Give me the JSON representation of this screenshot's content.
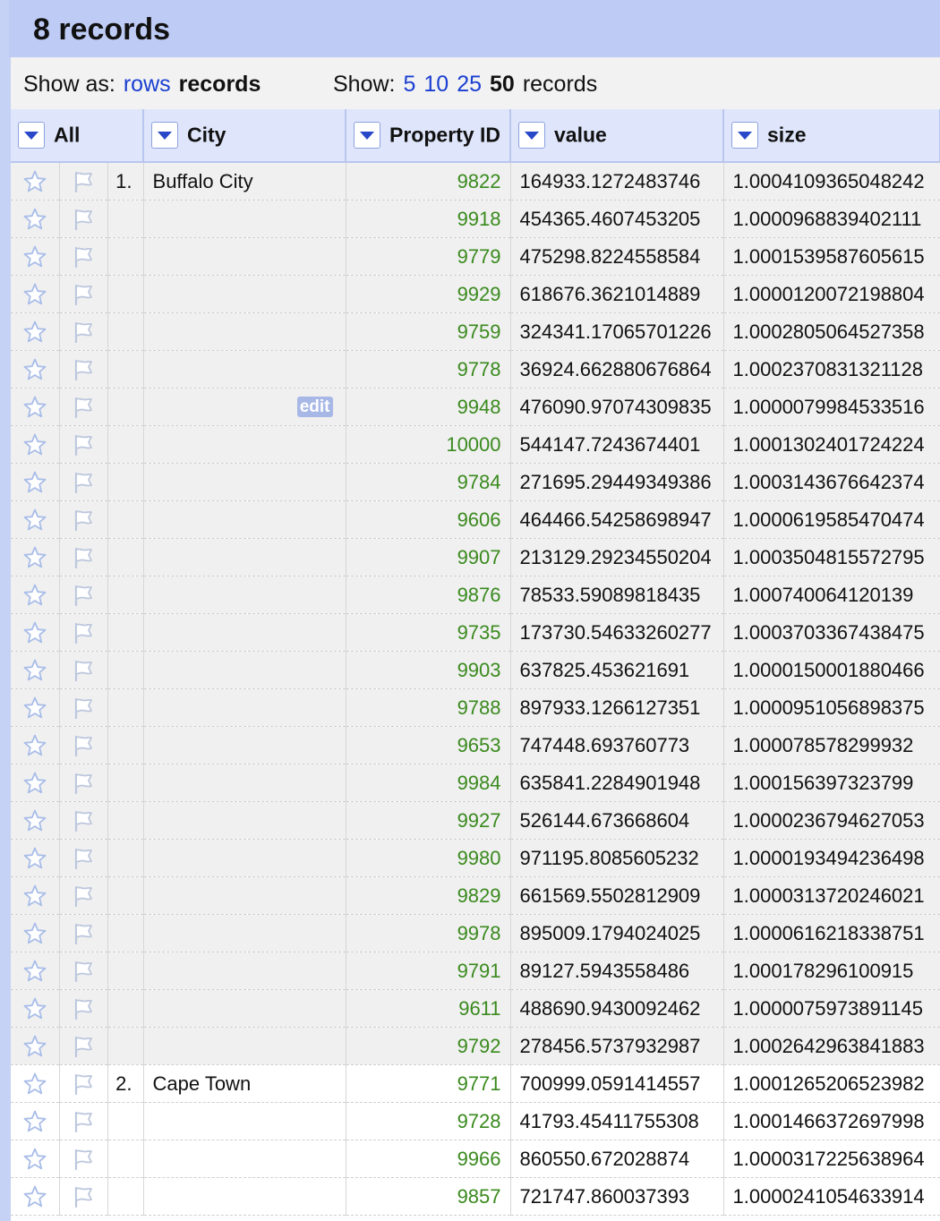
{
  "header": {
    "title": "8 records"
  },
  "controls": {
    "show_as_label": "Show as:",
    "show_as_rows": "rows",
    "show_as_records": "records",
    "show_label": "Show:",
    "page_sizes": [
      "5",
      "10",
      "25",
      "50"
    ],
    "page_size_selected": "50",
    "show_suffix": "records"
  },
  "columns": [
    {
      "label": "All"
    },
    {
      "label": "City"
    },
    {
      "label": "Property ID"
    },
    {
      "label": "value"
    },
    {
      "label": "size"
    }
  ],
  "edit_label": "edit",
  "icons": {
    "star": "star-outline-icon",
    "flag": "flag-outline-icon"
  },
  "colors": {
    "property_id": "#3a8a1e",
    "link": "#1a3fd1",
    "header_bg": "#bdcbf5"
  },
  "rows": [
    {
      "index": "1.",
      "city": "Buffalo City",
      "pid": "9822",
      "value": "164933.1272483746",
      "size": "1.0004109365048242",
      "group": 1
    },
    {
      "index": "",
      "city": "",
      "pid": "9918",
      "value": "454365.4607453205",
      "size": "1.0000968839402111",
      "group": 1
    },
    {
      "index": "",
      "city": "",
      "pid": "9779",
      "value": "475298.8224558584",
      "size": "1.0001539587605615",
      "group": 1
    },
    {
      "index": "",
      "city": "",
      "pid": "9929",
      "value": "618676.3621014889",
      "size": "1.0000120072198804",
      "group": 1
    },
    {
      "index": "",
      "city": "",
      "pid": "9759",
      "value": "324341.17065701226",
      "size": "1.0002805064527358",
      "group": 1
    },
    {
      "index": "",
      "city": "",
      "pid": "9778",
      "value": "36924.662880676864",
      "size": "1.0002370831321128",
      "group": 1
    },
    {
      "index": "",
      "city": "",
      "pid": "9948",
      "value": "476090.97074309835",
      "size": "1.0000079984533516",
      "group": 1,
      "edit": true
    },
    {
      "index": "",
      "city": "",
      "pid": "10000",
      "value": "544147.7243674401",
      "size": "1.0001302401724224",
      "group": 1
    },
    {
      "index": "",
      "city": "",
      "pid": "9784",
      "value": "271695.29449349386",
      "size": "1.0003143676642374",
      "group": 1
    },
    {
      "index": "",
      "city": "",
      "pid": "9606",
      "value": "464466.54258698947",
      "size": "1.0000619585470474",
      "group": 1
    },
    {
      "index": "",
      "city": "",
      "pid": "9907",
      "value": "213129.29234550204",
      "size": "1.0003504815572795",
      "group": 1
    },
    {
      "index": "",
      "city": "",
      "pid": "9876",
      "value": "78533.59089818435",
      "size": "1.000740064120139",
      "group": 1
    },
    {
      "index": "",
      "city": "",
      "pid": "9735",
      "value": "173730.54633260277",
      "size": "1.0003703367438475",
      "group": 1
    },
    {
      "index": "",
      "city": "",
      "pid": "9903",
      "value": "637825.453621691",
      "size": "1.0000150001880466",
      "group": 1
    },
    {
      "index": "",
      "city": "",
      "pid": "9788",
      "value": "897933.1266127351",
      "size": "1.0000951056898375",
      "group": 1
    },
    {
      "index": "",
      "city": "",
      "pid": "9653",
      "value": "747448.693760773",
      "size": "1.000078578299932",
      "group": 1
    },
    {
      "index": "",
      "city": "",
      "pid": "9984",
      "value": "635841.2284901948",
      "size": "1.000156397323799",
      "group": 1
    },
    {
      "index": "",
      "city": "",
      "pid": "9927",
      "value": "526144.673668604",
      "size": "1.0000236794627053",
      "group": 1
    },
    {
      "index": "",
      "city": "",
      "pid": "9980",
      "value": "971195.8085605232",
      "size": "1.0000193494236498",
      "group": 1
    },
    {
      "index": "",
      "city": "",
      "pid": "9829",
      "value": "661569.5502812909",
      "size": "1.0000313720246021",
      "group": 1
    },
    {
      "index": "",
      "city": "",
      "pid": "9978",
      "value": "895009.1794024025",
      "size": "1.0000616218338751",
      "group": 1
    },
    {
      "index": "",
      "city": "",
      "pid": "9791",
      "value": "89127.5943558486",
      "size": "1.000178296100915",
      "group": 1
    },
    {
      "index": "",
      "city": "",
      "pid": "9611",
      "value": "488690.9430092462",
      "size": "1.0000075973891145",
      "group": 1
    },
    {
      "index": "",
      "city": "",
      "pid": "9792",
      "value": "278456.5737932987",
      "size": "1.0002642963841883",
      "group": 1
    },
    {
      "index": "2.",
      "city": "Cape Town",
      "pid": "9771",
      "value": "700999.0591414557",
      "size": "1.0001265206523982",
      "group": 2
    },
    {
      "index": "",
      "city": "",
      "pid": "9728",
      "value": "41793.45411755308",
      "size": "1.0001466372697998",
      "group": 2
    },
    {
      "index": "",
      "city": "",
      "pid": "9966",
      "value": "860550.672028874",
      "size": "1.0000317225638964",
      "group": 2
    },
    {
      "index": "",
      "city": "",
      "pid": "9857",
      "value": "721747.860037393",
      "size": "1.0000241054633914",
      "group": 2
    }
  ]
}
